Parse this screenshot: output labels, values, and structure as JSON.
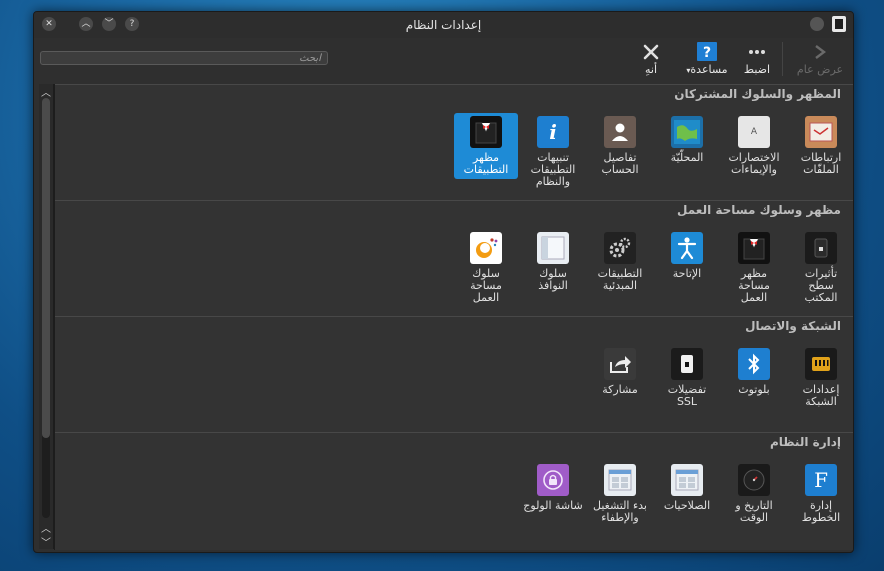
{
  "window": {
    "title": "إعدادات النظام"
  },
  "toolbar": {
    "overview": "عرض عام",
    "configure": "اضبط",
    "help": "مساعدة",
    "quit": "أنهِ"
  },
  "search": {
    "placeholder": "ابحث"
  },
  "sections": [
    {
      "title": "المظهر والسلوك المشتركان",
      "items": [
        {
          "label": "ارتباطات الملفّات",
          "icon": "file-associations-icon"
        },
        {
          "label": "الاختصارات والإيماءات",
          "icon": "shortcuts-icon"
        },
        {
          "label": "المحلّيّة",
          "icon": "locale-icon"
        },
        {
          "label": "تفاصيل الحساب",
          "icon": "account-icon"
        },
        {
          "label": "تنبيهات التطبيقات والنظام",
          "icon": "notifications-icon"
        },
        {
          "label": "مظهر التطبيقات",
          "icon": "application-style-icon",
          "selected": true
        }
      ]
    },
    {
      "title": "مظهر وسلوك مساحة العمل",
      "items": [
        {
          "label": "تأثيرات سطح المكتب",
          "icon": "desktop-effects-icon"
        },
        {
          "label": "مظهر مساحة العمل",
          "icon": "workspace-theme-icon"
        },
        {
          "label": "الإتاحة",
          "icon": "accessibility-icon"
        },
        {
          "label": "التطبيقات المبدئية",
          "icon": "default-applications-icon"
        },
        {
          "label": "سلوك النوافذ",
          "icon": "window-behavior-icon"
        },
        {
          "label": "سلوك مساحة العمل",
          "icon": "workspace-behavior-icon"
        }
      ]
    },
    {
      "title": "الشبكة والاتصال",
      "items": [
        {
          "label": "إعدادات الشبكة",
          "icon": "network-settings-icon"
        },
        {
          "label": "بلوتوث",
          "icon": "bluetooth-icon"
        },
        {
          "label": "تفضيلات SSL",
          "icon": "ssl-icon"
        },
        {
          "label": "مشاركة",
          "icon": "share-icon"
        }
      ]
    },
    {
      "title": "إدارة النظام",
      "items": [
        {
          "label": "إدارة الخطوط",
          "icon": "font-management-icon"
        },
        {
          "label": "التاريخ و الوقت",
          "icon": "date-time-icon"
        },
        {
          "label": "الصلاحيات",
          "icon": "permissions-icon"
        },
        {
          "label": "بدء التشغيل والإطفاء",
          "icon": "startup-shutdown-icon"
        },
        {
          "label": "شاشة الولوج",
          "icon": "login-screen-icon"
        }
      ]
    }
  ]
}
